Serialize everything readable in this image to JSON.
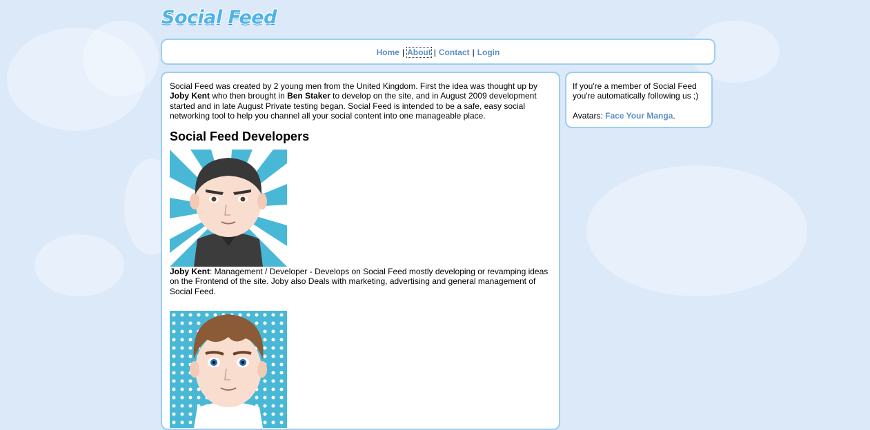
{
  "logo": {
    "text": "Social Feed"
  },
  "nav": {
    "items": [
      {
        "label": "Home"
      },
      {
        "label": "About"
      },
      {
        "label": "Contact"
      },
      {
        "label": "Login"
      }
    ],
    "separator": "|"
  },
  "main": {
    "intro": {
      "p1": "Social Feed was created by 2 young men from the United Kingdom. First the idea was thought up by ",
      "name1": "Joby Kent",
      "p2": " who then brought in ",
      "name2": "Ben Staker",
      "p3": " to develop on the site, and in August 2009 development started and in late August Private testing began. Social Feed is intended to be a safe, easy social networking tool to help you channel all your social content into one manageable place."
    },
    "heading": "Social Feed Developers",
    "developers": [
      {
        "name": "Joby Kent",
        "description": ": Management / Developer - Develops on Social Feed mostly developing or revamping ideas on the Frontend of the site. Joby also Deals with marketing, advertising and general management of Social Feed."
      },
      {
        "name": "",
        "description": ""
      }
    ]
  },
  "sidebar": {
    "follow_text": "If you're a member of Social Feed you're automatically following us ;)",
    "avatars_label": "Avatars: ",
    "avatars_link": "Face Your Manga",
    "avatars_suffix": "."
  },
  "colors": {
    "background": "#dbe9f9",
    "border": "#9ccef2",
    "link": "#5a8fc4",
    "logo": "#4fb3e8"
  }
}
